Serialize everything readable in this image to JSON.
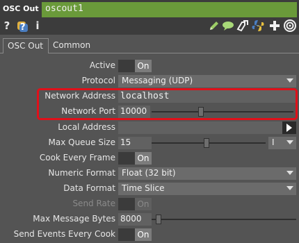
{
  "header": {
    "op_type": "OSC Out",
    "op_name": "oscout1"
  },
  "toolbar": {
    "left": [
      {
        "icon": "help-icon",
        "glyph": "?"
      },
      {
        "icon": "python-help-icon",
        "glyph": "?"
      },
      {
        "icon": "info-icon",
        "glyph": "i"
      }
    ],
    "right": [
      "pencil-icon",
      "comment-icon",
      "clone-icon",
      "python-icon",
      "add-icon",
      "viewer-icon"
    ]
  },
  "tabs": [
    "OSC Out",
    "Common"
  ],
  "params": {
    "active": {
      "label": "Active",
      "value": "On"
    },
    "protocol": {
      "label": "Protocol",
      "value": "Messaging (UDP)"
    },
    "network_address": {
      "label": "Network Address",
      "value": "localhost"
    },
    "network_port": {
      "label": "Network Port",
      "value": "10000",
      "slider_fraction": 0.35
    },
    "local_address": {
      "label": "Local Address",
      "value": ""
    },
    "max_queue_size": {
      "label": "Max Queue Size",
      "value": "15",
      "slider_fraction": 0.48,
      "unit": "I"
    },
    "cook_every_frame": {
      "label": "Cook Every Frame",
      "value": "On"
    },
    "numeric_format": {
      "label": "Numeric Format",
      "value": "Float (32 bit)"
    },
    "data_format": {
      "label": "Data Format",
      "value": "Time Slice"
    },
    "send_rate": {
      "label": "Send Rate",
      "value": "On"
    },
    "max_message_bytes": {
      "label": "Max Message Bytes",
      "value": "8000",
      "slider_fraction": 0.05
    },
    "send_events_every_cook": {
      "label": "Send Events Every Cook",
      "value": "On"
    }
  },
  "colors": {
    "name_field": "#6a9a3a",
    "highlight_box": "#e0101a",
    "panel_bg": "#545454"
  }
}
